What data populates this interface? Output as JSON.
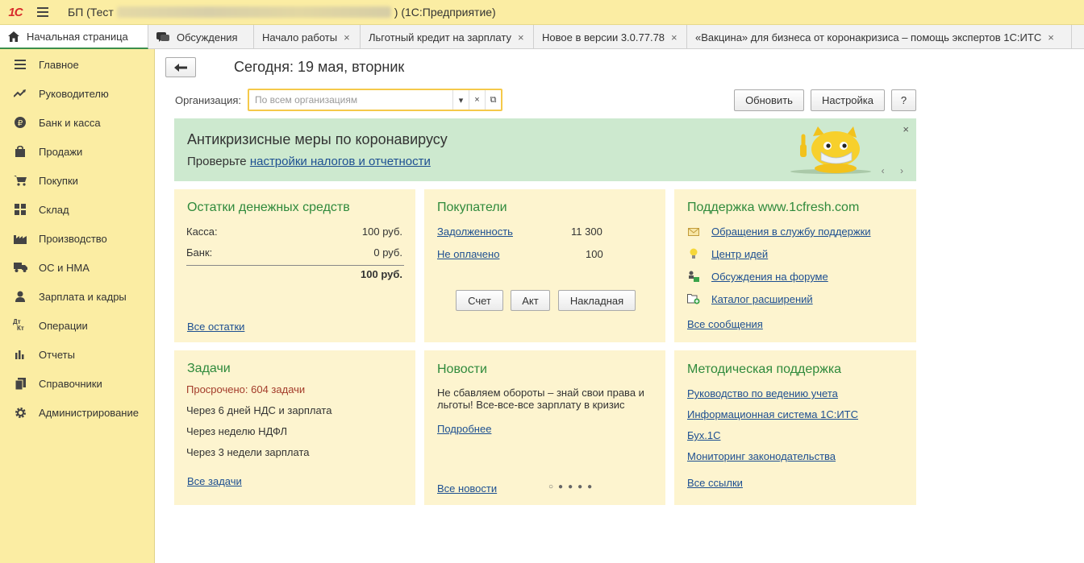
{
  "titlebar": {
    "logo": "1С",
    "title_prefix": "БП (Тест",
    "title_suffix": ")  (1С:Предприятие)"
  },
  "tabs": [
    {
      "label": "Начальная страница",
      "icon": "home-icon",
      "active": true
    },
    {
      "label": "Обсуждения",
      "icon": "chat-icon"
    },
    {
      "label": "Начало работы",
      "close": "×"
    },
    {
      "label": "Льготный кредит на зарплату",
      "close": "×"
    },
    {
      "label": "Новое в версии 3.0.77.78",
      "close": "×"
    },
    {
      "label": "«Вакцина» для бизнеса от коронакризиса – помощь экспертов 1С:ИТС",
      "close": "×"
    }
  ],
  "sidebar": {
    "items": [
      {
        "label": "Главное",
        "icon": "menu-icon"
      },
      {
        "label": "Руководителю",
        "icon": "trend-icon"
      },
      {
        "label": "Банк и касса",
        "icon": "ruble-icon"
      },
      {
        "label": "Продажи",
        "icon": "bag-icon"
      },
      {
        "label": "Покупки",
        "icon": "cart-icon"
      },
      {
        "label": "Склад",
        "icon": "grid-icon"
      },
      {
        "label": "Производство",
        "icon": "factory-icon"
      },
      {
        "label": "ОС и НМА",
        "icon": "truck-icon"
      },
      {
        "label": "Зарплата и кадры",
        "icon": "person-icon"
      },
      {
        "label": "Операции",
        "icon": "dtkt-icon"
      },
      {
        "label": "Отчеты",
        "icon": "bar-chart-icon"
      },
      {
        "label": "Справочники",
        "icon": "book-icon"
      },
      {
        "label": "Администрирование",
        "icon": "gear-icon"
      }
    ]
  },
  "main": {
    "today": "Сегодня: 19 мая, вторник",
    "org_label": "Организация:",
    "org_placeholder": "По всем организациям",
    "refresh_label": "Обновить",
    "settings_label": "Настройка",
    "help_label": "?"
  },
  "banner": {
    "title": "Антикризисные меры по коронавирусу",
    "text": "Проверьте ",
    "link": "настройки налогов и отчетности",
    "close": "×",
    "arrows": "‹ ›"
  },
  "cash": {
    "title": "Остатки денежных средств",
    "rows": [
      {
        "label": "Касса:",
        "value": "100 руб."
      },
      {
        "label": "Банк:",
        "value": "0 руб."
      }
    ],
    "total": "100 руб.",
    "link": "Все остатки"
  },
  "buyers": {
    "title": "Покупатели",
    "rows": [
      {
        "label": "Задолженность",
        "value": "11 300"
      },
      {
        "label": "Не оплачено",
        "value": "100"
      }
    ],
    "buttons": [
      "Счет",
      "Акт",
      "Накладная"
    ]
  },
  "support": {
    "title": "Поддержка www.1cfresh.com",
    "links": [
      {
        "label": "Обращения в службу поддержки",
        "icon": "envelope-icon"
      },
      {
        "label": "Центр идей",
        "icon": "lightbulb-icon"
      },
      {
        "label": "Обсуждения на форуме",
        "icon": "forum-icon"
      },
      {
        "label": "Каталог расширений",
        "icon": "folder-add-icon"
      }
    ],
    "all": "Все сообщения"
  },
  "tasks": {
    "title": "Задачи",
    "overdue": "Просрочено: 604 задачи",
    "items": [
      "Через 6 дней НДС и зарплата",
      "Через неделю НДФЛ",
      "Через 3 недели зарплата"
    ],
    "link": "Все задачи"
  },
  "news": {
    "title": "Новости",
    "text": "Не сбавляем обороты – знай свои права и льготы! Все-все-все зарплату в кризис",
    "more": "Подробнее",
    "all": "Все новости"
  },
  "method": {
    "title": "Методическая поддержка",
    "links": [
      "Руководство по ведению учета",
      "Информационная система 1С:ИТС",
      "Бух.1С",
      "Мониторинг законодательства"
    ],
    "all": "Все ссылки"
  },
  "colors": {
    "sidebar": "#fbeda3",
    "panel": "#fdf4cf",
    "banner": "#cde9cf",
    "accent_green": "#2f8a3c",
    "link": "#1d4f91",
    "overdue": "#a33b2a"
  }
}
